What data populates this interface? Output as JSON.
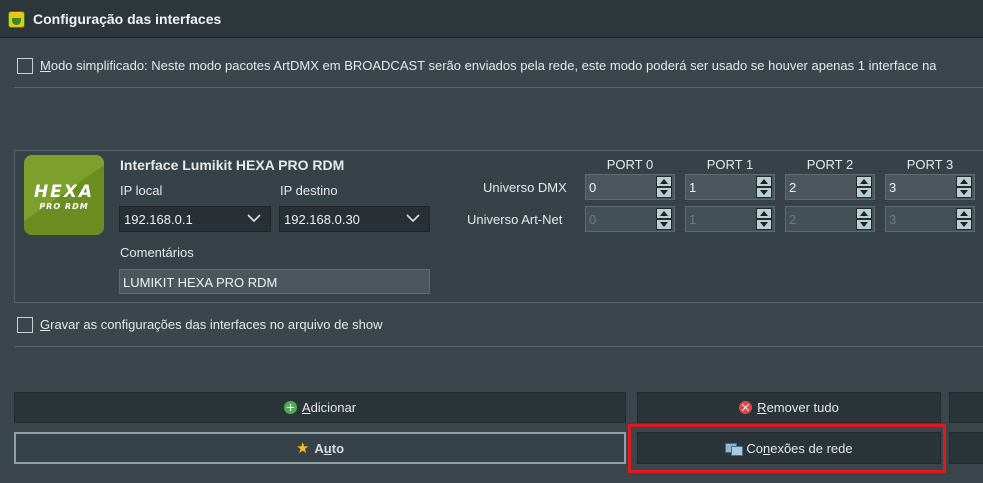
{
  "window": {
    "title": "Configuração das interfaces"
  },
  "simplified_mode": {
    "checked": false,
    "prefix_underlined": "M",
    "label_rest": "odo simplificado: Neste modo pacotes ArtDMX em BROADCAST serão enviados pela rede, este modo poderá ser usado se houver apenas 1 interface na"
  },
  "interface": {
    "logo_line1": "HEXA",
    "logo_line2": "PRO RDM",
    "name": "Interface Lumikit HEXA PRO RDM",
    "ip_local_label": "IP local",
    "ip_local_value": "192.168.0.1",
    "ip_dest_label": "IP destino",
    "ip_dest_value": "192.168.0.30",
    "comments_label": "Comentários",
    "comments_value": "LUMIKIT HEXA PRO RDM",
    "ports": [
      "PORT 0",
      "PORT 1",
      "PORT 2",
      "PORT 3"
    ],
    "universo_dmx_label": "Universo DMX",
    "universo_dmx": [
      "0",
      "1",
      "2",
      "3"
    ],
    "universo_artnet_label": "Universo Art-Net",
    "universo_artnet": [
      "0",
      "1",
      "2",
      "3"
    ]
  },
  "save_config": {
    "checked": false,
    "prefix_underlined": "G",
    "label_rest": "ravar as configurações das interfaces no arquivo de show"
  },
  "buttons": {
    "add_underlined": "A",
    "add_rest": "dicionar",
    "remove_underlined": "R",
    "remove_rest": "emover tudo",
    "auto_pre": "A",
    "auto_underlined": "u",
    "auto_post": "to",
    "network_pre": "Co",
    "network_underlined": "n",
    "network_post": "exões de rede"
  },
  "colors": {
    "highlight": "#e0181f",
    "background": "#3b464c"
  },
  "icons": {
    "add": "plus-circle-icon",
    "remove": "x-circle-icon",
    "auto": "star-icon",
    "network": "network-icon",
    "dropdown": "chevron-down-icon"
  }
}
